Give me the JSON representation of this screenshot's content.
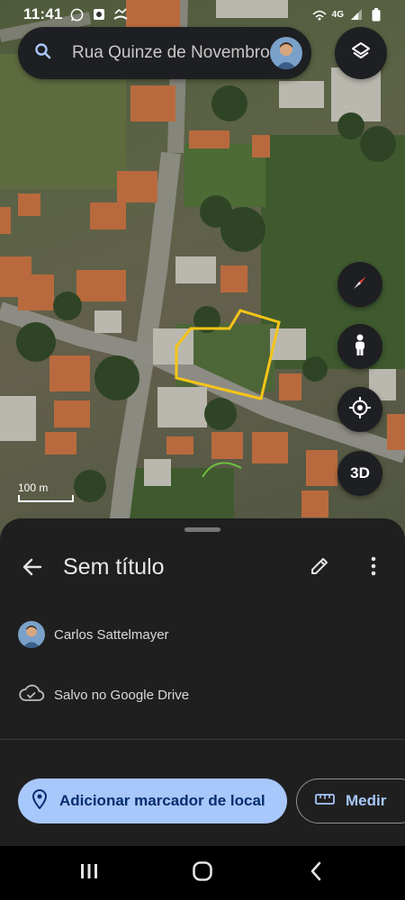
{
  "status_bar": {
    "time": "11:41",
    "network": "4G",
    "icons": [
      "whatsapp-icon",
      "photo-icon",
      "missed-call-icon",
      "wifi-calling-icon",
      "signal-icon",
      "battery-icon"
    ]
  },
  "search": {
    "text": "Rua Quinze de Novembro",
    "icon": "search-icon"
  },
  "map": {
    "scale_label": "100 m",
    "outline_color": "#f5c518",
    "controls": {
      "layers": "layers-icon",
      "compass": "compass-icon",
      "street_view": "pegman-icon",
      "my_location": "my-location-icon",
      "three_d_label": "3D"
    }
  },
  "sheet": {
    "title": "Sem título",
    "author": "Carlos Sattelmayer",
    "save_status": "Salvo no Google Drive",
    "primary_action": "Adicionar marcador de local",
    "secondary_action": "Medir"
  },
  "colors": {
    "accent": "#a8c7fa",
    "accent_text": "#062e6f",
    "sheet_bg": "#1f1f1f"
  }
}
